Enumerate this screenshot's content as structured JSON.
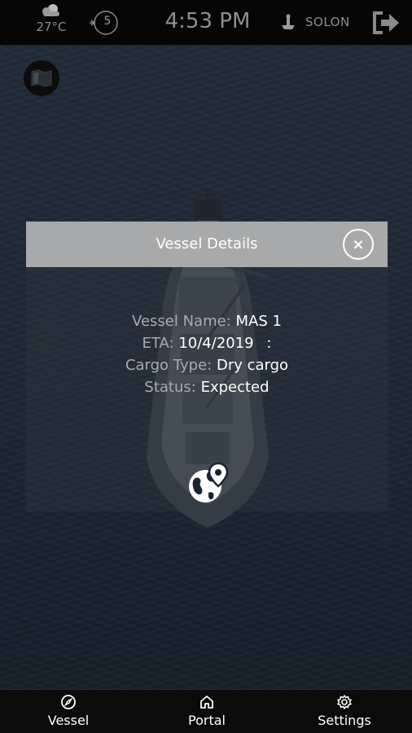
{
  "status_bar": {
    "temperature": "27°C",
    "wind_speed": "5",
    "time": "4:53 PM",
    "location": "SOLON",
    "icons": [
      "cloud-icon",
      "wind-compass-icon",
      "anchor-icon",
      "logout-icon"
    ]
  },
  "dialog": {
    "title": "Vessel Details",
    "close_label": "×",
    "vessel_name_label": "Vessel Name:",
    "vessel_name": "MAS 1",
    "eta_label": "ETA:",
    "eta": "10/4/2019",
    "eta_suffix": ":",
    "cargo_type_label": "Cargo Type:",
    "cargo_type": "Dry cargo",
    "status_label": "Status:",
    "status": "Expected",
    "location_button_icon": "globe-pin-icon"
  },
  "bottom_nav": {
    "items": [
      {
        "label": "Vessel",
        "icon": "compass-icon"
      },
      {
        "label": "Portal",
        "icon": "home-icon"
      },
      {
        "label": "Settings",
        "icon": "gear-icon"
      }
    ]
  },
  "colors": {
    "bar_background": "#060606",
    "dialog_header": "#a7a9ab",
    "text_white": "#ffffff",
    "label_grey": "#a8acb0"
  }
}
